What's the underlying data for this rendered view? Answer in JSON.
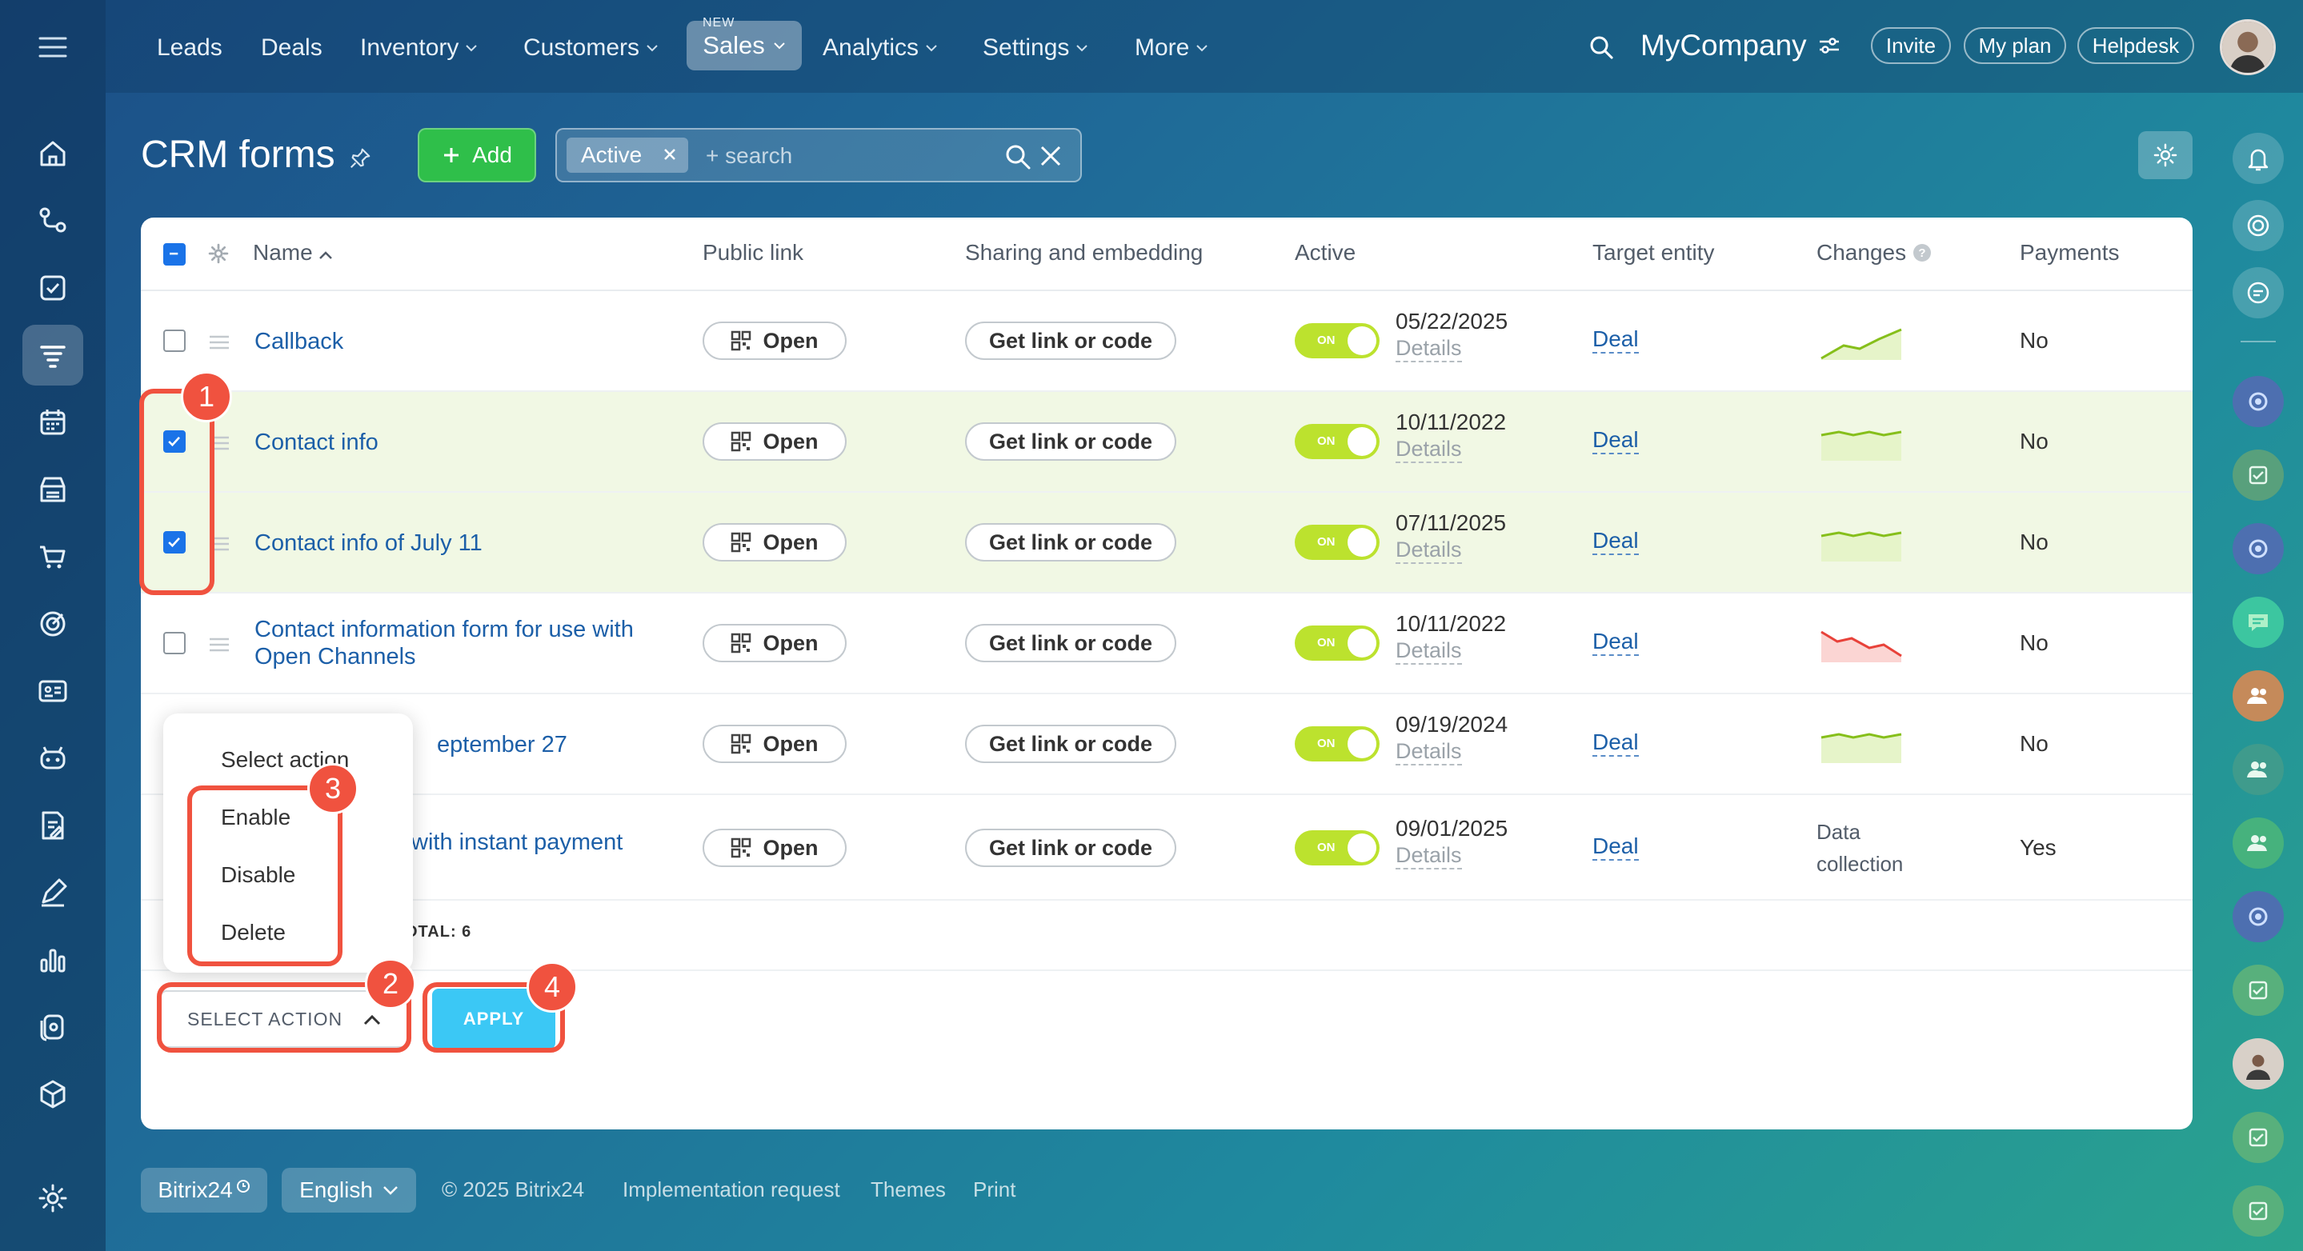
{
  "nav": {
    "items": [
      {
        "label": "Leads",
        "chevron": false
      },
      {
        "label": "Deals",
        "chevron": false
      },
      {
        "label": "Inventory",
        "chevron": true
      },
      {
        "label": "Customers",
        "chevron": true
      },
      {
        "label": "Analytics",
        "chevron": true
      },
      {
        "label": "Settings",
        "chevron": true
      },
      {
        "label": "More",
        "chevron": true
      }
    ],
    "sales": {
      "label": "Sales",
      "badge": "NEW"
    }
  },
  "header": {
    "company": "MyCompany",
    "invite": "Invite",
    "my_plan": "My plan",
    "helpdesk": "Helpdesk"
  },
  "page": {
    "title": "CRM forms",
    "add_label": "Add",
    "filter_chip": "Active",
    "search_placeholder": "+ search"
  },
  "table": {
    "columns": {
      "name": "Name",
      "public_link": "Public link",
      "sharing": "Sharing and embedding",
      "active": "Active",
      "target": "Target entity",
      "changes": "Changes",
      "payments": "Payments"
    },
    "open_label": "Open",
    "get_link_label": "Get link or code",
    "toggle_label": "ON",
    "details_label": "Details",
    "rows": [
      {
        "name": "Callback",
        "checked": false,
        "date": "05/22/2025",
        "target": "Deal",
        "changes": "up",
        "payments": "No"
      },
      {
        "name": "Contact info",
        "checked": true,
        "date": "10/11/2022",
        "target": "Deal",
        "changes": "flat",
        "payments": "No"
      },
      {
        "name": "Contact info of July 11",
        "checked": true,
        "date": "07/11/2025",
        "target": "Deal",
        "changes": "flat",
        "payments": "No"
      },
      {
        "name": "Contact information form for use with",
        "name2": "Open Channels",
        "checked": false,
        "date": "10/11/2022",
        "target": "Deal",
        "changes": "down",
        "payments": "No"
      },
      {
        "name": "eptember 27",
        "checked": false,
        "date": "09/19/2024",
        "target": "Deal",
        "changes": "flat",
        "payments": "No"
      },
      {
        "name": "with instant payment",
        "checked": false,
        "date": "09/01/2025",
        "target": "Deal",
        "changes_text": "Data",
        "changes_text2": "collection",
        "payments": "Yes"
      }
    ],
    "total_label": "OTAL: ",
    "total_value": "6"
  },
  "actions": {
    "menu": [
      "Select action",
      "Enable",
      "Disable",
      "Delete"
    ],
    "select_label": "SELECT ACTION",
    "apply_label": "APPLY"
  },
  "badges": [
    "1",
    "2",
    "3",
    "4"
  ],
  "footer": {
    "brand": "Bitrix24",
    "language": "English",
    "copyright": "© 2025 Bitrix24",
    "links": [
      "Implementation request",
      "Themes",
      "Print"
    ]
  },
  "colors": {
    "accent_green": "#2fbf4a",
    "toggle": "#bce22e",
    "link": "#1c5fa8",
    "apply": "#3bc8f5",
    "highlight": "#f0523f"
  }
}
